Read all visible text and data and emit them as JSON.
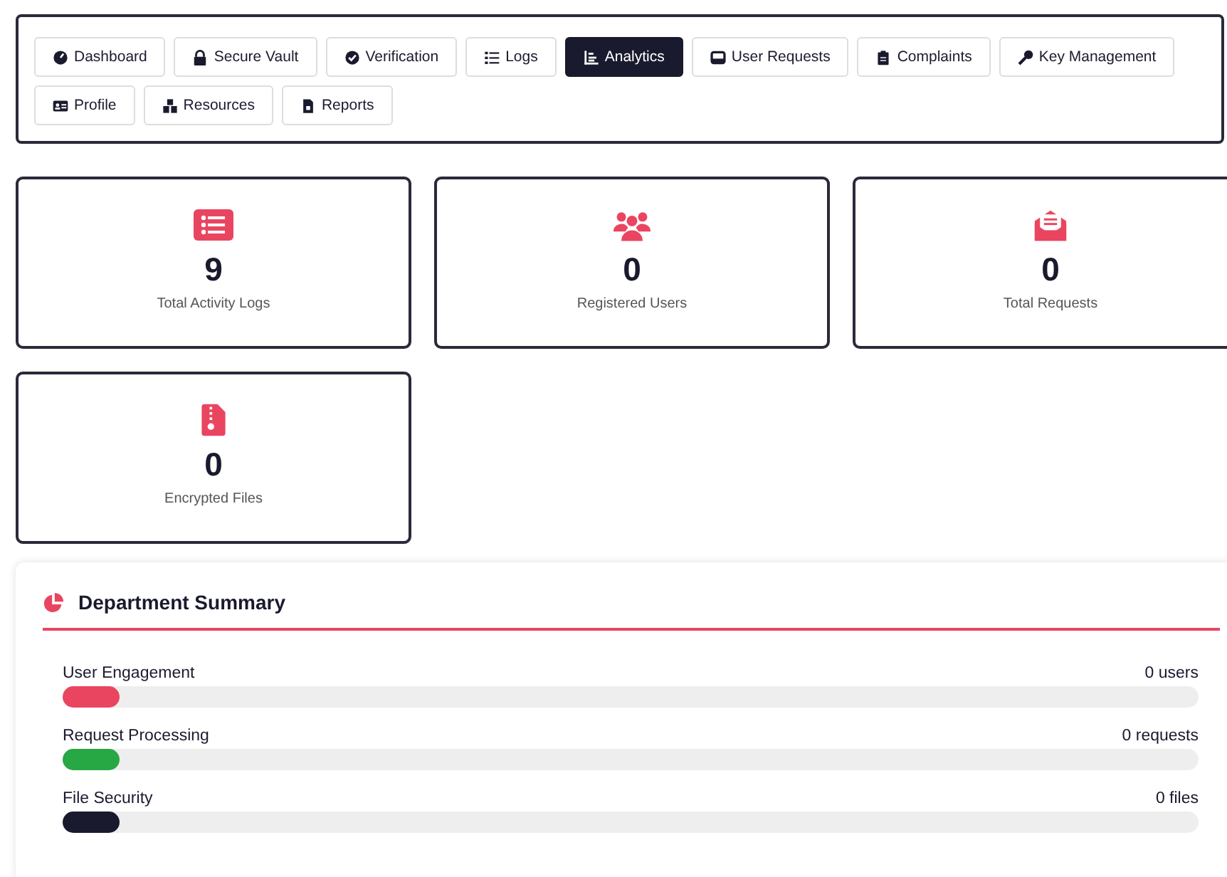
{
  "nav_tabs": [
    {
      "label": "Dashboard",
      "selected": false
    },
    {
      "label": "Secure Vault",
      "selected": false
    },
    {
      "label": "Verification",
      "selected": false
    },
    {
      "label": "Logs",
      "selected": false
    },
    {
      "label": "Analytics",
      "selected": true
    },
    {
      "label": "User Requests",
      "selected": false
    },
    {
      "label": "Complaints",
      "selected": false
    },
    {
      "label": "Key Management",
      "selected": false
    },
    {
      "label": "Profile",
      "selected": false
    },
    {
      "label": "Resources",
      "selected": false
    },
    {
      "label": "Reports",
      "selected": false
    }
  ],
  "stat_cards": [
    {
      "value": "9",
      "label": "Total Activity Logs"
    },
    {
      "value": "0",
      "label": "Registered Users"
    },
    {
      "value": "0",
      "label": "Total Requests"
    },
    {
      "value": "0",
      "label": "Encrypted Files"
    }
  ],
  "department_summary": {
    "title": "Department Summary",
    "metrics": [
      {
        "label": "User Engagement",
        "reading": "0 users",
        "level": 0.05,
        "color": "#e94560"
      },
      {
        "label": "Request Processing",
        "reading": "0 requests",
        "level": 0.05,
        "color": "#28a745"
      },
      {
        "label": "File Security",
        "reading": "0 files",
        "level": 0.05,
        "color": "#1a1a2e"
      }
    ]
  }
}
